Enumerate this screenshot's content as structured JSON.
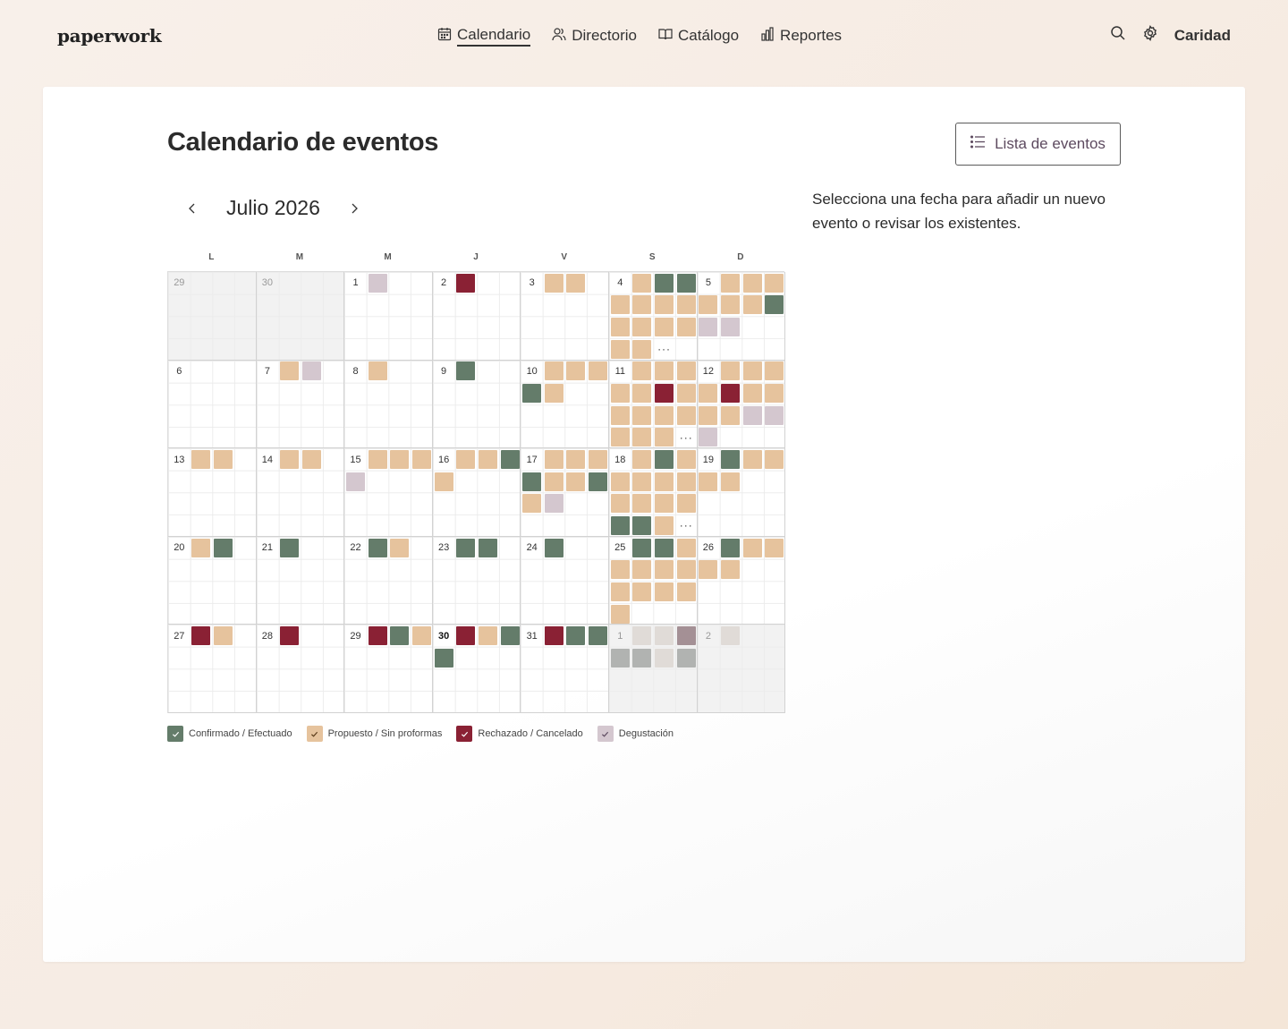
{
  "app": {
    "logo": "paperwork",
    "org_name": "Caridad"
  },
  "nav": [
    {
      "label": "Calendario",
      "icon": "calendar-icon",
      "active": true
    },
    {
      "label": "Directorio",
      "icon": "users-icon",
      "active": false
    },
    {
      "label": "Catálogo",
      "icon": "book-icon",
      "active": false
    },
    {
      "label": "Reportes",
      "icon": "bar-chart-icon",
      "active": false
    }
  ],
  "page": {
    "title": "Calendario de eventos",
    "list_button": "Lista de eventos",
    "help_text": "Selecciona una fecha para añadir un nuevo evento o revisar los existentes."
  },
  "calendar": {
    "month_label": "Julio 2026",
    "weekdays": [
      "L",
      "M",
      "M",
      "J",
      "V",
      "S",
      "D"
    ],
    "today": 30,
    "more_label": "···",
    "colors": {
      "confirmed": "#647c6a",
      "proposed": "#e6c39d",
      "rejected": "#8a2134",
      "tasting": "#d4c7cf"
    },
    "days": [
      {
        "num": "29",
        "other": true,
        "events": []
      },
      {
        "num": "30",
        "other": true,
        "events": []
      },
      {
        "num": "1",
        "events": [
          "tasting"
        ]
      },
      {
        "num": "2",
        "events": [
          "rejected"
        ]
      },
      {
        "num": "3",
        "events": [
          "proposed",
          "proposed"
        ]
      },
      {
        "num": "4",
        "events": [
          "proposed",
          "confirmed",
          "confirmed",
          "proposed",
          "proposed",
          "proposed",
          "proposed",
          "proposed",
          "proposed",
          "proposed",
          "proposed",
          "proposed",
          "proposed"
        ],
        "more": true
      },
      {
        "num": "5",
        "events": [
          "proposed",
          "proposed",
          "proposed",
          "proposed",
          "proposed",
          "proposed",
          "confirmed",
          "tasting",
          "tasting"
        ]
      },
      {
        "num": "6",
        "events": []
      },
      {
        "num": "7",
        "events": [
          "proposed",
          "tasting"
        ]
      },
      {
        "num": "8",
        "events": [
          "proposed"
        ]
      },
      {
        "num": "9",
        "events": [
          "confirmed"
        ]
      },
      {
        "num": "10",
        "events": [
          "proposed",
          "proposed",
          "proposed",
          "confirmed",
          "proposed"
        ]
      },
      {
        "num": "11",
        "events": [
          "proposed",
          "proposed",
          "proposed",
          "proposed",
          "proposed",
          "rejected",
          "proposed",
          "proposed",
          "proposed",
          "proposed",
          "proposed",
          "proposed",
          "proposed",
          "proposed"
        ],
        "more": true
      },
      {
        "num": "12",
        "events": [
          "proposed",
          "proposed",
          "proposed",
          "proposed",
          "rejected",
          "proposed",
          "proposed",
          "proposed",
          "proposed",
          "tasting",
          "tasting",
          "tasting"
        ]
      },
      {
        "num": "13",
        "events": [
          "proposed",
          "proposed"
        ]
      },
      {
        "num": "14",
        "events": [
          "proposed",
          "proposed"
        ]
      },
      {
        "num": "15",
        "events": [
          "proposed",
          "proposed",
          "proposed",
          "tasting"
        ]
      },
      {
        "num": "16",
        "events": [
          "proposed",
          "proposed",
          "confirmed",
          "proposed"
        ]
      },
      {
        "num": "17",
        "events": [
          "proposed",
          "proposed",
          "proposed",
          "confirmed",
          "proposed",
          "proposed",
          "confirmed",
          "proposed",
          "tasting"
        ]
      },
      {
        "num": "18",
        "events": [
          "proposed",
          "confirmed",
          "proposed",
          "proposed",
          "proposed",
          "proposed",
          "proposed",
          "proposed",
          "proposed",
          "proposed",
          "proposed",
          "confirmed",
          "confirmed",
          "proposed"
        ],
        "more": true
      },
      {
        "num": "19",
        "events": [
          "confirmed",
          "proposed",
          "proposed",
          "proposed",
          "proposed"
        ]
      },
      {
        "num": "20",
        "events": [
          "proposed",
          "confirmed"
        ]
      },
      {
        "num": "21",
        "events": [
          "confirmed"
        ]
      },
      {
        "num": "22",
        "events": [
          "confirmed",
          "proposed"
        ]
      },
      {
        "num": "23",
        "events": [
          "confirmed",
          "confirmed"
        ]
      },
      {
        "num": "24",
        "events": [
          "confirmed"
        ]
      },
      {
        "num": "25",
        "events": [
          "confirmed",
          "confirmed",
          "proposed",
          "proposed",
          "proposed",
          "proposed",
          "proposed",
          "proposed",
          "proposed",
          "proposed",
          "proposed",
          "proposed"
        ]
      },
      {
        "num": "26",
        "events": [
          "confirmed",
          "proposed",
          "proposed",
          "proposed",
          "proposed"
        ]
      },
      {
        "num": "27",
        "events": [
          "rejected",
          "proposed"
        ]
      },
      {
        "num": "28",
        "events": [
          "rejected"
        ]
      },
      {
        "num": "29",
        "events": [
          "rejected",
          "confirmed",
          "proposed"
        ]
      },
      {
        "num": "30",
        "events": [
          "rejected",
          "proposed",
          "confirmed",
          "confirmed"
        ]
      },
      {
        "num": "31",
        "events": [
          "rejected",
          "confirmed",
          "confirmed"
        ]
      },
      {
        "num": "1",
        "other": true,
        "events": [
          "o-proposed",
          "o-proposed",
          "o-tasting",
          "o-confirmed",
          "o-confirmed",
          "o-proposed",
          "o-confirmed"
        ]
      },
      {
        "num": "2",
        "other": true,
        "events": [
          "o-proposed"
        ]
      }
    ]
  },
  "legend": [
    {
      "label": "Confirmado / Efectuado",
      "color": "#647c6a"
    },
    {
      "label": "Propuesto / Sin proformas",
      "color": "#e6c39d"
    },
    {
      "label": "Rechazado / Cancelado",
      "color": "#8a2134"
    },
    {
      "label": "Degustación",
      "color": "#d4c7cf"
    }
  ]
}
